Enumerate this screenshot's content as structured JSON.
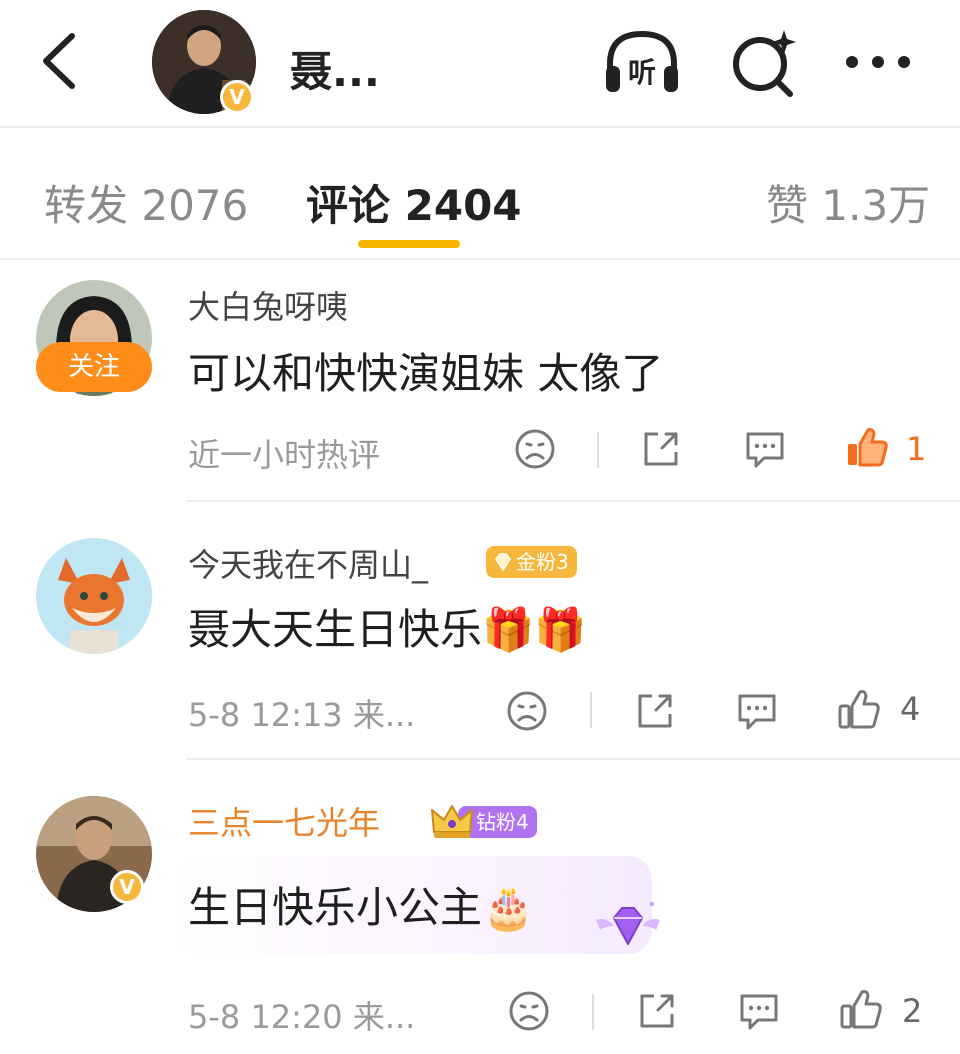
{
  "header": {
    "name": "聂...",
    "verified_badge": "V",
    "listen_label": "听"
  },
  "tabs": [
    {
      "label": "转发 2076"
    },
    {
      "label": "评论 2404"
    },
    {
      "label": "赞 1.3万"
    }
  ],
  "comments": [
    {
      "username": "大白兔呀咦",
      "follow_label": "关注",
      "text": "可以和快快演姐妹 太像了",
      "meta": "近一小时热评",
      "likes": "1",
      "liked": true
    },
    {
      "username": "今天我在不周山_",
      "badge": "金粉3",
      "text": "聂大天生日快乐🎁🎁",
      "meta": "5-8 12:13 来...",
      "likes": "4"
    },
    {
      "username": "三点一七光年",
      "badge": "钻粉4",
      "verified_badge": "V",
      "text": "生日快乐小公主🎂",
      "meta": "5-8 12:20 来...",
      "likes": "2"
    }
  ],
  "colors": {
    "accent": "#f7b500",
    "follow": "#ff8d1a",
    "like_active": "#f76b1c",
    "gold_name": "#e8832a",
    "gold_badge": "#f6b83c",
    "diamond_badge": "#b072f0"
  }
}
